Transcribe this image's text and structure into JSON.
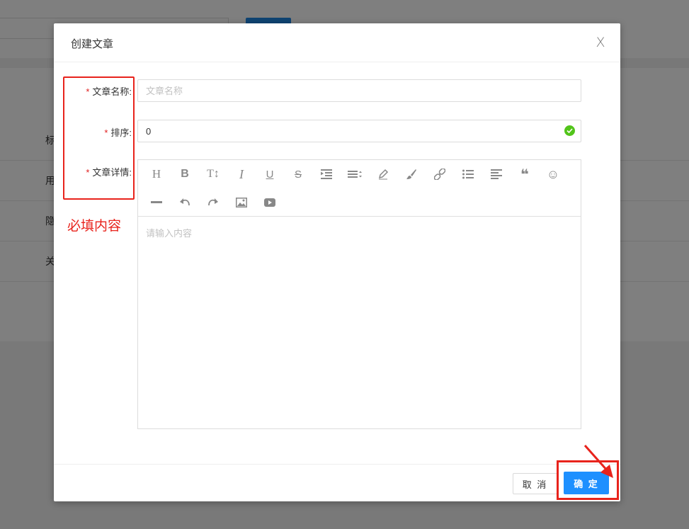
{
  "modal": {
    "title": "创建文章",
    "close_glyph": "X"
  },
  "form": {
    "name": {
      "label": "文章名称:",
      "required_mark": "*",
      "placeholder": "文章名称",
      "value": ""
    },
    "order": {
      "label": "排序:",
      "required_mark": "*",
      "value": "0",
      "status_icon": "check-circle-icon"
    },
    "detail": {
      "label": "文章详情:",
      "required_mark": "*",
      "placeholder": "请输入内容"
    }
  },
  "editor_toolbar": [
    {
      "name": "heading-icon",
      "glyph": "H"
    },
    {
      "name": "bold-icon",
      "glyph": "B"
    },
    {
      "name": "font-size-icon",
      "glyph": "T↕"
    },
    {
      "name": "italic-icon",
      "glyph": "I"
    },
    {
      "name": "underline-icon",
      "glyph": "U"
    },
    {
      "name": "strikethrough-icon",
      "glyph": "S"
    },
    {
      "name": "indent-icon",
      "glyph": ""
    },
    {
      "name": "line-height-icon",
      "glyph": ""
    },
    {
      "name": "font-color-icon",
      "glyph": ""
    },
    {
      "name": "background-color-icon",
      "glyph": ""
    },
    {
      "name": "link-icon",
      "glyph": ""
    },
    {
      "name": "list-icon",
      "glyph": ""
    },
    {
      "name": "align-icon",
      "glyph": ""
    },
    {
      "name": "quote-icon",
      "glyph": "❝"
    },
    {
      "name": "emoji-icon",
      "glyph": "☺"
    },
    {
      "name": "divider-icon",
      "glyph": ""
    },
    {
      "name": "undo-icon",
      "glyph": ""
    },
    {
      "name": "redo-icon",
      "glyph": ""
    },
    {
      "name": "image-icon",
      "glyph": ""
    },
    {
      "name": "video-icon",
      "glyph": ""
    }
  ],
  "annotation": {
    "text": "必填内容"
  },
  "footer": {
    "cancel_label": "取 消",
    "ok_label": "确 定"
  },
  "background": {
    "rows": [
      "标",
      "用",
      "隐",
      "关"
    ]
  },
  "colors": {
    "primary": "#1e90ff",
    "annotation": "#e8231c",
    "success": "#52c41a"
  }
}
